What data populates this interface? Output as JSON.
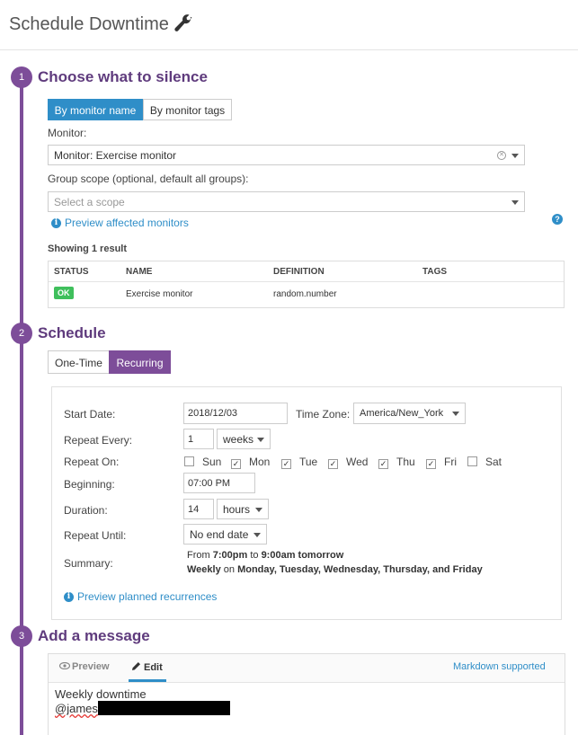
{
  "header": {
    "title": "Schedule Downtime"
  },
  "steps": [
    {
      "num": "1",
      "title": "Choose what to silence"
    },
    {
      "num": "2",
      "title": "Schedule"
    },
    {
      "num": "3",
      "title": "Add a message"
    }
  ],
  "silence": {
    "btn_name": "By monitor name",
    "btn_tags": "By monitor tags",
    "monitor_label": "Monitor:",
    "monitor_value": "Monitor: Exercise monitor",
    "scope_label": "Group scope (optional, default all groups):",
    "scope_placeholder": "Select a scope",
    "preview_link": "Preview affected monitors",
    "showing": "Showing 1 result",
    "table": {
      "headers": [
        "STATUS",
        "NAME",
        "DEFINITION",
        "TAGS"
      ],
      "row": {
        "status": "OK",
        "name": "Exercise monitor",
        "definition": "random.number",
        "tags": ""
      }
    }
  },
  "schedule": {
    "btn_onetime": "One-Time",
    "btn_recurring": "Recurring",
    "start_label": "Start Date:",
    "start_value": "2018/12/03",
    "tz_label": "Time Zone:",
    "tz_value": "America/New_York",
    "repeat_every_label": "Repeat Every:",
    "repeat_every_value": "1",
    "repeat_every_unit": "weeks",
    "repeat_on_label": "Repeat On:",
    "days": [
      {
        "label": "Sun",
        "checked": false
      },
      {
        "label": "Mon",
        "checked": true
      },
      {
        "label": "Tue",
        "checked": true
      },
      {
        "label": "Wed",
        "checked": true
      },
      {
        "label": "Thu",
        "checked": true
      },
      {
        "label": "Fri",
        "checked": true
      },
      {
        "label": "Sat",
        "checked": false
      }
    ],
    "beginning_label": "Beginning:",
    "beginning_value": "07:00 PM",
    "duration_label": "Duration:",
    "duration_value": "14",
    "duration_unit": "hours",
    "repeat_until_label": "Repeat Until:",
    "repeat_until_value": "No end date",
    "summary_label": "Summary:",
    "summary_l1": {
      "a": "From ",
      "b": "7:00pm",
      "c": " to ",
      "d": "9:00am tomorrow"
    },
    "summary_l2": {
      "a": "Weekly",
      "b": " on ",
      "c": "Monday, Tuesday, Wednesday, Thursday, and Friday"
    },
    "preview_link": "Preview planned recurrences"
  },
  "message": {
    "tab_preview": "Preview",
    "tab_edit": "Edit",
    "markdown": "Markdown supported",
    "line1": "Weekly downtime",
    "line2": "@james"
  },
  "colors": {
    "accent_purple": "#7d4d99",
    "accent_blue": "#2f8ec8",
    "ok_green": "#3fbf5c"
  }
}
